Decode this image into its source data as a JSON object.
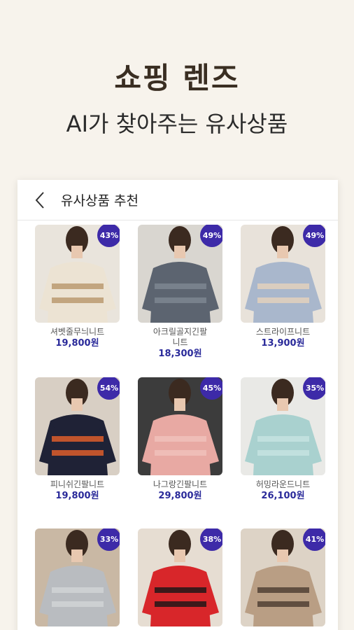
{
  "hero": {
    "title": "쇼핑 렌즈",
    "subtitle": "AI가 찾아주는 유사상품"
  },
  "header": {
    "title": "유사상품 추천",
    "back_icon": "chevron-left-icon"
  },
  "colors": {
    "badge": "#3d2aa8",
    "price": "#2a2a9a",
    "background": "#f7f3ec"
  },
  "products": [
    {
      "name": "셔벳줄무늬니트",
      "price": "19,800원",
      "discount": "43%",
      "sweater": "#ece3d3",
      "stripe": "#b8956a",
      "bg": "#e9e4dc"
    },
    {
      "name": "아크릴골지긴팔\n니트",
      "price": "18,300원",
      "discount": "49%",
      "sweater": "#5c6470",
      "stripe": "#7f8894",
      "bg": "#d9d6d0"
    },
    {
      "name": "스트라이프니트",
      "price": "13,900원",
      "discount": "49%",
      "sweater": "#a9b7cc",
      "stripe": "#e6d2bb",
      "bg": "#e8e2da"
    },
    {
      "name": "피니쉬긴팔니트",
      "price": "19,800원",
      "discount": "54%",
      "sweater": "#1f2236",
      "stripe": "#e8612a",
      "bg": "#d8cfc4"
    },
    {
      "name": "나그랑긴팔니트",
      "price": "29,800원",
      "discount": "45%",
      "sweater": "#e8a9a3",
      "stripe": "#f0c2bc",
      "bg": "#3c3c3c"
    },
    {
      "name": "허밍라운드니트",
      "price": "26,100원",
      "discount": "35%",
      "sweater": "#a9d1cf",
      "stripe": "#c7e3e1",
      "bg": "#e9e9e6"
    },
    {
      "name": "",
      "price": "",
      "discount": "33%",
      "sweater": "#b9bcc0",
      "stripe": "#d2d4d6",
      "bg": "#c9b8a4"
    },
    {
      "name": "",
      "price": "",
      "discount": "38%",
      "sweater": "#d8262a",
      "stripe": "#161616",
      "bg": "#e6ddd2"
    },
    {
      "name": "",
      "price": "",
      "discount": "41%",
      "sweater": "#b99e84",
      "stripe": "#4a3a2f",
      "bg": "#ddd3c6"
    }
  ]
}
